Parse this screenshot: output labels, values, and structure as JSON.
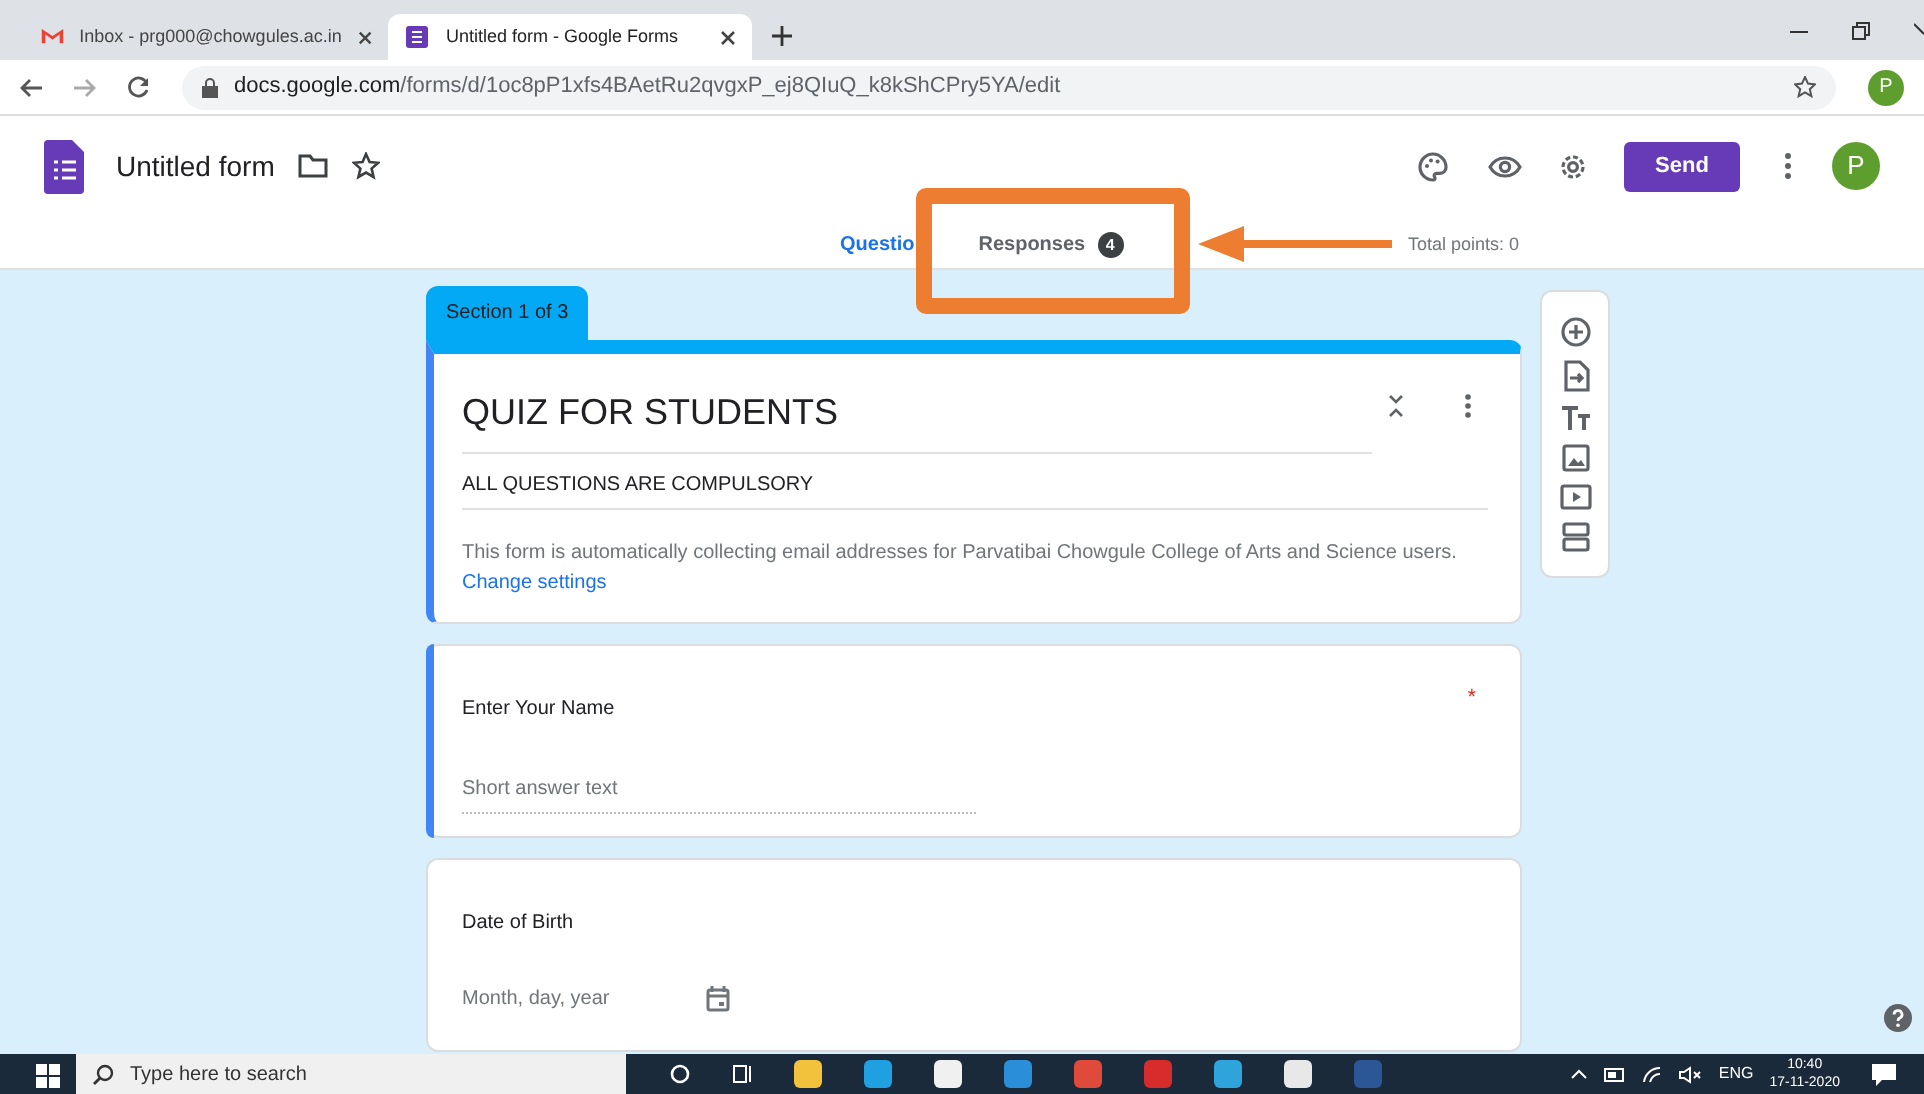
{
  "browser": {
    "tabs": [
      {
        "title": "Inbox - prg000@chowgules.ac.in",
        "selected": false
      },
      {
        "title": "Untitled form - Google Forms",
        "selected": true
      }
    ],
    "url_host": "docs.google.com",
    "url_path": "/forms/d/1oc8pP1xfs4BAetRu2qvgxP_ej8QIuQ_k8kShCPry5YA/edit",
    "profile": "P"
  },
  "header": {
    "title": "Untitled form",
    "send": "Send",
    "avatar": "P"
  },
  "tabs": [
    {
      "label": "Questio",
      "selected": true
    },
    {
      "label": "Responses",
      "selected": false,
      "count": "4"
    }
  ],
  "total_points": "Total points: 0",
  "form": {
    "section": "Section 1 of 3",
    "title": "QUIZ FOR STUDENTS",
    "description": "ALL QUESTIONS ARE COMPULSORY",
    "notice": "This form is automatically collecting email addresses for Parvatibai Chowgule College of Arts and Science users.",
    "notice_link": "Change settings"
  },
  "questions": [
    {
      "kind": "short",
      "title": "Enter Your Name",
      "required_mark": "*",
      "active": true,
      "placeholder": "Short answer text"
    },
    {
      "kind": "date",
      "title": "Date of Birth",
      "active": false,
      "placeholder": "Month, day, year"
    }
  ],
  "taskbar": {
    "search": "Type here to search",
    "language": "ENG",
    "time": "10:40",
    "date": "17-11-2020"
  }
}
